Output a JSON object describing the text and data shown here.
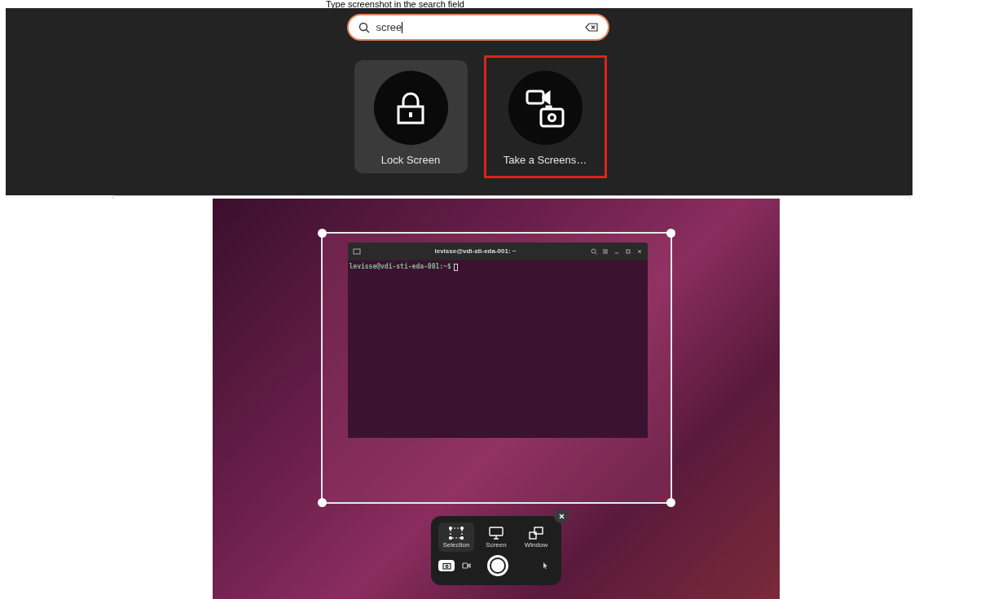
{
  "instruction": "Type screenshot in the search field",
  "search": {
    "value": "scree"
  },
  "apps": [
    {
      "label": "Lock Screen",
      "kind": "lock",
      "selected": true,
      "highlighted": false
    },
    {
      "label": "Take a Screens…",
      "kind": "screenshot",
      "selected": false,
      "highlighted": true
    }
  ],
  "terminal": {
    "title": "levisse@vdi-sti-eda-001: ~",
    "prompt": "levisse@vdi-sti-eda-001:~$"
  },
  "screenshot_tool": {
    "modes": [
      {
        "label": "Selection",
        "kind": "selection",
        "selected": true
      },
      {
        "label": "Screen",
        "kind": "screen",
        "selected": false
      },
      {
        "label": "Window",
        "kind": "window",
        "selected": false
      }
    ],
    "capture": [
      {
        "kind": "photo",
        "selected": true
      },
      {
        "kind": "video",
        "selected": false
      }
    ],
    "show_pointer": false
  }
}
